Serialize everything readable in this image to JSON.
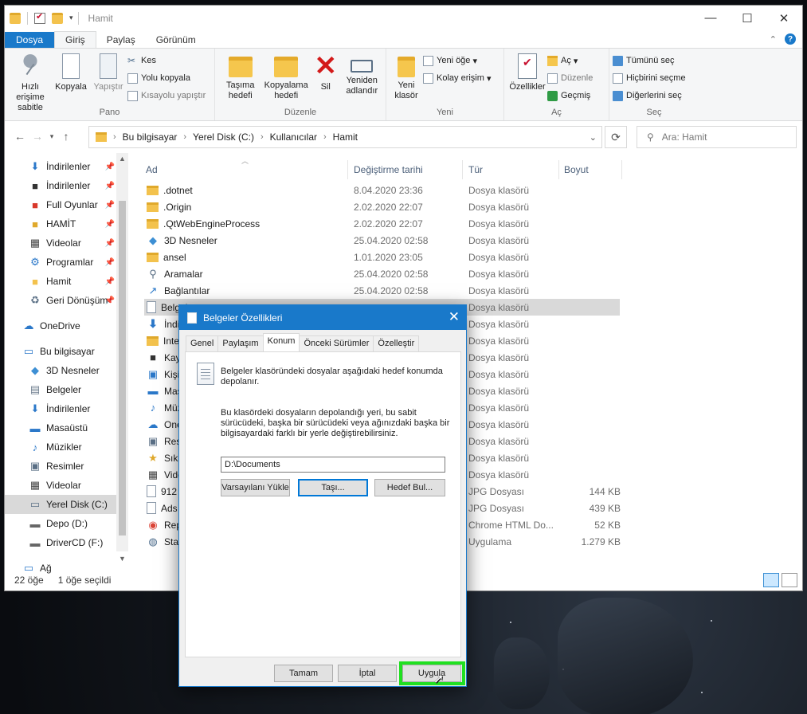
{
  "window": {
    "title": "Hamit"
  },
  "ribbon": {
    "tabs": [
      "Dosya",
      "Giriş",
      "Paylaş",
      "Görünüm"
    ],
    "groups": {
      "pano": {
        "label": "Pano",
        "pin": "Hızlı erişime sabitle",
        "copy": "Kopyala",
        "paste": "Yapıştır",
        "cut": "Kes",
        "copy_path": "Yolu kopyala",
        "paste_shortcut": "Kısayolu yapıştır"
      },
      "duzenle": {
        "label": "Düzenle",
        "move_to": "Taşıma hedefi",
        "copy_to": "Kopyalama hedefi",
        "delete": "Sil",
        "rename": "Yeniden adlandır"
      },
      "yeni": {
        "label": "Yeni",
        "new_folder": "Yeni klasör",
        "new_item": "Yeni öğe",
        "easy_access": "Kolay erişim"
      },
      "ac": {
        "label": "Aç",
        "properties": "Özellikler",
        "open": "Aç",
        "edit": "Düzenle",
        "history": "Geçmiş"
      },
      "sec": {
        "label": "Seç",
        "select_all": "Tümünü seç",
        "select_none": "Hiçbirini seçme",
        "invert": "Diğerlerini seç"
      }
    }
  },
  "address": {
    "crumbs": [
      "Bu bilgisayar",
      "Yerel Disk (C:)",
      "Kullanıcılar",
      "Hamit"
    ],
    "search_placeholder": "Ara: Hamit"
  },
  "nav": {
    "items": [
      {
        "label": "İndirilenler",
        "icon": "download-icon",
        "pinned": true
      },
      {
        "label": "İndirilenler",
        "icon": "game-icon",
        "pinned": true
      },
      {
        "label": "Full Oyunlar",
        "icon": "folder-icon",
        "pinned": true
      },
      {
        "label": "HAMİT",
        "icon": "folder-icon",
        "pinned": true
      },
      {
        "label": "Videolar",
        "icon": "video-icon",
        "pinned": true
      },
      {
        "label": "Programlar",
        "icon": "gear-icon",
        "pinned": true
      },
      {
        "label": "Hamit",
        "icon": "folder-icon",
        "pinned": true
      },
      {
        "label": "Geri Dönüşüm",
        "icon": "recycle-icon",
        "pinned": true
      },
      {
        "label": "OneDrive",
        "icon": "cloud-icon",
        "pinned": false
      },
      {
        "label": "Bu bilgisayar",
        "icon": "computer-icon",
        "pinned": false
      },
      {
        "label": "3D Nesneler",
        "icon": "cube-icon",
        "pinned": false
      },
      {
        "label": "Belgeler",
        "icon": "document-icon",
        "pinned": false
      },
      {
        "label": "İndirilenler",
        "icon": "download-icon",
        "pinned": false
      },
      {
        "label": "Masaüstü",
        "icon": "desktop-icon",
        "pinned": false
      },
      {
        "label": "Müzikler",
        "icon": "music-icon",
        "pinned": false
      },
      {
        "label": "Resimler",
        "icon": "picture-icon",
        "pinned": false
      },
      {
        "label": "Videolar",
        "icon": "video-icon",
        "pinned": false
      },
      {
        "label": "Yerel Disk (C:)",
        "icon": "drive-icon",
        "pinned": false
      },
      {
        "label": "Depo (D:)",
        "icon": "drive-icon",
        "pinned": false
      },
      {
        "label": "DriverCD (F:)",
        "icon": "drive-icon",
        "pinned": false
      },
      {
        "label": "Ağ",
        "icon": "network-icon",
        "pinned": false
      }
    ]
  },
  "columns": [
    "Ad",
    "Değiştirme tarihi",
    "Tür",
    "Boyut"
  ],
  "files": [
    {
      "name": ".dotnet",
      "date": "8.04.2020 23:36",
      "type": "Dosya klasörü",
      "size": "",
      "icon": "folder-icon"
    },
    {
      "name": ".Origin",
      "date": "2.02.2020 22:07",
      "type": "Dosya klasörü",
      "size": "",
      "icon": "folder-icon"
    },
    {
      "name": ".QtWebEngineProcess",
      "date": "2.02.2020 22:07",
      "type": "Dosya klasörü",
      "size": "",
      "icon": "folder-icon"
    },
    {
      "name": "3D Nesneler",
      "date": "25.04.2020 02:58",
      "type": "Dosya klasörü",
      "size": "",
      "icon": "cube-icon"
    },
    {
      "name": "ansel",
      "date": "1.01.2020 23:05",
      "type": "Dosya klasörü",
      "size": "",
      "icon": "folder-icon"
    },
    {
      "name": "Aramalar",
      "date": "25.04.2020 02:58",
      "type": "Dosya klasörü",
      "size": "",
      "icon": "search-icon"
    },
    {
      "name": "Bağlantılar",
      "date": "25.04.2020 02:58",
      "type": "Dosya klasörü",
      "size": "",
      "icon": "link-icon"
    },
    {
      "name": "Belgel",
      "date": "",
      "type": "Dosya klasörü",
      "size": "",
      "icon": "document-icon"
    },
    {
      "name": "İndi",
      "date": "",
      "type": "Dosya klasörü",
      "size": "",
      "icon": "download-icon"
    },
    {
      "name": "Inte",
      "date": "",
      "type": "Dosya klasörü",
      "size": "",
      "icon": "folder-icon"
    },
    {
      "name": "Kayı",
      "date": "",
      "type": "Dosya klasörü",
      "size": "",
      "icon": "game-icon"
    },
    {
      "name": "Kişil",
      "date": "",
      "type": "Dosya klasörü",
      "size": "",
      "icon": "contacts-icon"
    },
    {
      "name": "Mas",
      "date": "",
      "type": "Dosya klasörü",
      "size": "",
      "icon": "desktop-icon"
    },
    {
      "name": "Müz",
      "date": "",
      "type": "Dosya klasörü",
      "size": "",
      "icon": "music-icon"
    },
    {
      "name": "One",
      "date": "",
      "type": "Dosya klasörü",
      "size": "",
      "icon": "cloud-icon"
    },
    {
      "name": "Resi",
      "date": "",
      "type": "Dosya klasörü",
      "size": "",
      "icon": "picture-icon"
    },
    {
      "name": "Sık h",
      "date": "",
      "type": "Dosya klasörü",
      "size": "",
      "icon": "star-icon"
    },
    {
      "name": "Vide",
      "date": "",
      "type": "Dosya klasörü",
      "size": "",
      "icon": "video-icon"
    },
    {
      "name": "912",
      "date": "",
      "type": "JPG Dosyası",
      "size": "144 KB",
      "icon": "image-file-icon"
    },
    {
      "name": "Ads",
      "date": "",
      "type": "JPG Dosyası",
      "size": "439 KB",
      "icon": "image-file-icon"
    },
    {
      "name": "Rep",
      "date": "",
      "type": "Chrome HTML Do...",
      "size": "52 KB",
      "icon": "chrome-icon"
    },
    {
      "name": "Stat",
      "date": "",
      "type": "Uygulama",
      "size": "1.279 KB",
      "icon": "app-icon"
    }
  ],
  "status": {
    "count": "22 öğe",
    "selected": "1 öğe seçildi"
  },
  "dialog": {
    "title": "Belgeler Özellikleri",
    "tabs": [
      "Genel",
      "Paylaşım",
      "Konum",
      "Önceki Sürümler",
      "Özelleştir"
    ],
    "active_tab": "Konum",
    "text1": "Belgeler klasöründeki dosyalar aşağıdaki hedef konumda depolanır.",
    "text2": "Bu klasördeki dosyaların depolandığı yeri, bu sabit sürücüdeki, başka bir sürücüdeki veya ağınızdaki başka bir bilgisayardaki farklı bir yerle değiştirebilirsiniz.",
    "path_value": "D:\\Documents",
    "btn_default": "Varsayılanı Yükle",
    "btn_move": "Taşı...",
    "btn_find": "Hedef Bul...",
    "btn_ok": "Tamam",
    "btn_cancel": "İptal",
    "btn_apply": "Uygula"
  },
  "colors": {
    "accent": "#1979ca",
    "highlight": "#20e020",
    "folder": "#f3c24d"
  }
}
